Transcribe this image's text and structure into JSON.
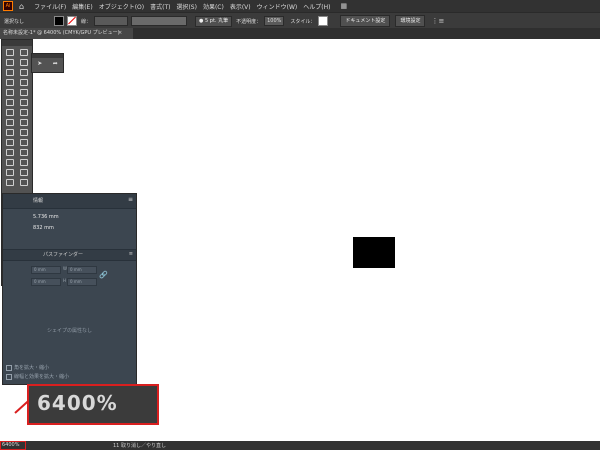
{
  "app": {
    "logo": "Ai"
  },
  "menubar": {
    "home_icon": "home-icon",
    "items": [
      "ファイル(F)",
      "編集(E)",
      "オブジェクト(O)",
      "書式(T)",
      "選択(S)",
      "効果(C)",
      "表示(V)",
      "ウィンドウ(W)",
      "ヘルプ(H)"
    ],
    "workspace_icon": "workspace-icon"
  },
  "control_bar": {
    "selection_label": "選択なし",
    "stroke_label": "線：",
    "stroke_weight": "5 pt. 丸筆",
    "opacity_label": "不透明度：",
    "opacity_value": "100%",
    "style_label": "スタイル：",
    "doc_setup_button": "ドキュメント設定",
    "prefs_button": "環境設定"
  },
  "document_tab": {
    "title": "名称未設定-1* @ 6400% (CMYK/GPU プレビュー)",
    "close": "×"
  },
  "info_panel": {
    "tab_label": "情報",
    "width_value": "5.736 mm",
    "height_value": "832 mm",
    "tab2_pathfinder": "パスファインダー",
    "no_shape": "シェイプの属性なし",
    "check1": "角を拡大・縮小",
    "check2": "線幅と効果を拡大・縮小",
    "dim_w_label": "W",
    "dim_h_label": "H",
    "dim_x_label": "X",
    "dim_y_label": "Y",
    "dim_unit": "0 mm"
  },
  "status_bar": {
    "zoom": "6400%",
    "info": "11 取り消し／やり直し"
  },
  "callout": {
    "zoom": "6400%"
  }
}
